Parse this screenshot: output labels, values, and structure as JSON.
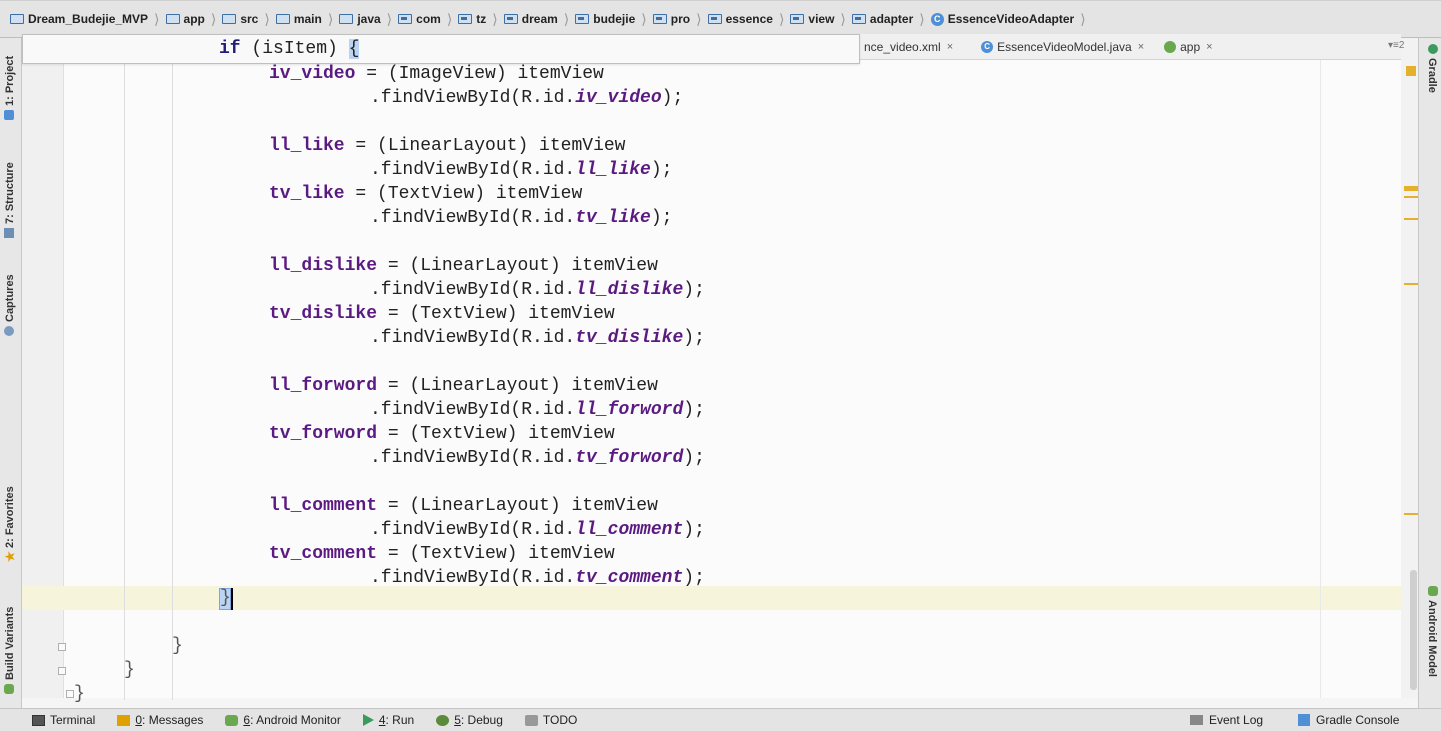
{
  "breadcrumb": [
    {
      "label": "Dream_Budejie_MVP",
      "icon": "project-folder-icon"
    },
    {
      "label": "app",
      "icon": "module-folder-icon"
    },
    {
      "label": "src",
      "icon": "folder-icon"
    },
    {
      "label": "main",
      "icon": "folder-icon"
    },
    {
      "label": "java",
      "icon": "folder-icon"
    },
    {
      "label": "com",
      "icon": "package-icon"
    },
    {
      "label": "tz",
      "icon": "package-icon"
    },
    {
      "label": "dream",
      "icon": "package-icon"
    },
    {
      "label": "budejie",
      "icon": "package-icon"
    },
    {
      "label": "pro",
      "icon": "package-icon"
    },
    {
      "label": "essence",
      "icon": "package-icon"
    },
    {
      "label": "view",
      "icon": "package-icon"
    },
    {
      "label": "adapter",
      "icon": "package-icon"
    },
    {
      "label": "EssenceVideoAdapter",
      "icon": "class-icon"
    }
  ],
  "tabs": [
    {
      "label": "nce_video.xml",
      "close": "×"
    },
    {
      "label": "EssenceVideoModel.java",
      "close": "×",
      "icon": "C"
    },
    {
      "label": "app",
      "close": "×"
    }
  ],
  "tabs_more": "▾≡2",
  "left_tools": {
    "project": "1: Project",
    "structure": "7: Structure",
    "captures": "Captures",
    "favorites": "2: Favorites",
    "build_variants": "Build Variants"
  },
  "right_tools": {
    "gradle": "Gradle",
    "android_model": "Android Model"
  },
  "sticky": {
    "kw": "if",
    "rest": " (isItem) ",
    "brace": "{"
  },
  "code": [
    {
      "v": "iv_video",
      "cast": "(ImageView) itemView",
      "id": "iv_video"
    },
    {
      "v": "ll_like",
      "cast": "(LinearLayout) itemView",
      "id": "ll_like"
    },
    {
      "v": "tv_like",
      "cast": "(TextView) itemView",
      "id": "tv_like"
    },
    {
      "v": "ll_dislike",
      "cast": "(LinearLayout) itemView",
      "id": "ll_dislike"
    },
    {
      "v": "tv_dislike",
      "cast": "(TextView) itemView",
      "id": "tv_dislike"
    },
    {
      "v": "ll_forword",
      "cast": "(LinearLayout) itemView",
      "id": "ll_forword"
    },
    {
      "v": "tv_forword",
      "cast": "(TextView) itemView",
      "id": "tv_forword"
    },
    {
      "v": "ll_comment",
      "cast": "(LinearLayout) itemView",
      "id": "ll_comment"
    },
    {
      "v": "tv_comment",
      "cast": "(TextView) itemView",
      "id": "tv_comment"
    }
  ],
  "find_prefix": ".findViewById(R.id.",
  "find_suffix": ");",
  "assign": " = ",
  "closing_brace": "}",
  "status": {
    "terminal": "Terminal",
    "messages_key": "0",
    "messages": ": Messages",
    "monitor_key": "6",
    "monitor": ": Android Monitor",
    "run_key": "4",
    "run": ": Run",
    "debug_key": "5",
    "debug": ": Debug",
    "todo": "TODO",
    "event_log": "Event Log",
    "gradle_console": "Gradle Console"
  },
  "colors": {
    "accent": "#4e8fd6",
    "keyword": "#1f1f7a",
    "field": "#5b1a82",
    "caret_line": "#f7f4dc",
    "marker": "#e3b12b"
  }
}
